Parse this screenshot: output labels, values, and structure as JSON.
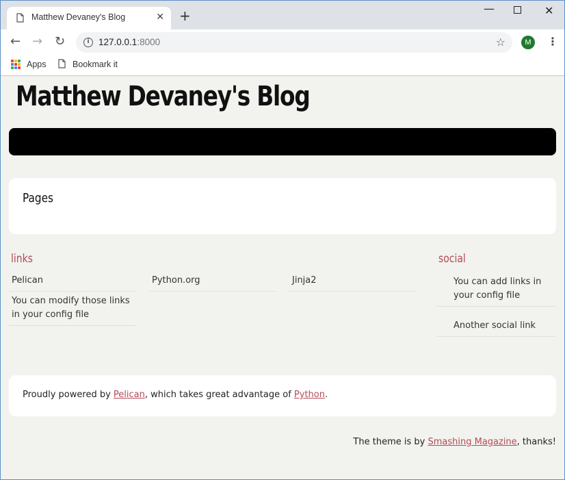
{
  "browser": {
    "tab_title": "Matthew Devaney's Blog",
    "tab_close": "✕",
    "new_tab": "+",
    "url_host": "127.0.0.1",
    "url_port": ":8000",
    "avatar_letter": "M",
    "bookmarks": [
      {
        "label": "Apps",
        "icon": "apps-grid-icon"
      },
      {
        "label": "Bookmark it",
        "icon": "document-icon"
      }
    ],
    "apps_colors": [
      "#ea4335",
      "#fbbc05",
      "#34a853",
      "#4285f4",
      "#ea4335",
      "#fbbc05",
      "#34a853",
      "#4285f4",
      "#ea4335"
    ]
  },
  "site": {
    "title": "Matthew Devaney's Blog",
    "pages_heading": "Pages",
    "links_heading": "links",
    "links": [
      "Pelican",
      "You can modify those links in your config file",
      "Python.org",
      "Jinja2"
    ],
    "social_heading": "social",
    "social": [
      "You can add links in your config file",
      "Another social link"
    ],
    "footer": {
      "prefix": "Proudly powered by ",
      "link1": "Pelican",
      "middle": ", which takes great advantage of ",
      "link2": "Python",
      "suffix": "."
    },
    "theme": {
      "prefix": "The theme is by ",
      "link": "Smashing Magazine",
      "suffix": ", thanks!"
    }
  },
  "colors": {
    "accent": "#b34b56",
    "navbar": "#000000",
    "page_bg": "#f2f2ee"
  }
}
